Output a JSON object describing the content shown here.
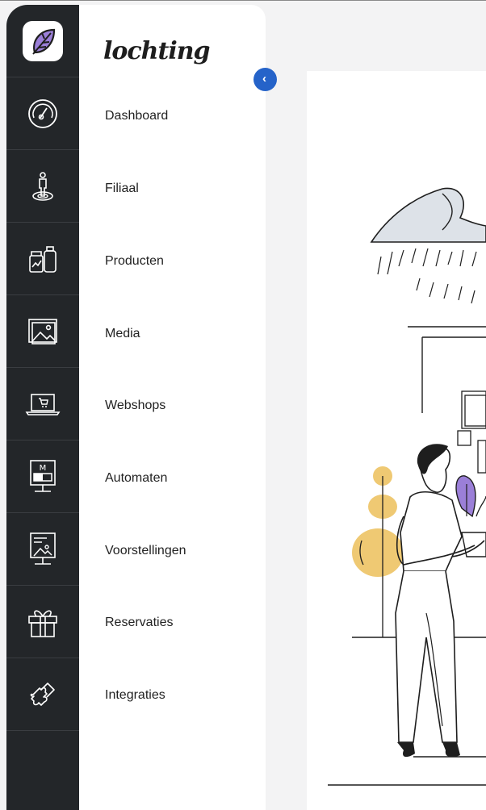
{
  "brand": {
    "logo_text": "lochting"
  },
  "sidebar": {
    "items": [
      {
        "label": "Dashboard",
        "icon": "gauge-icon"
      },
      {
        "label": "Filiaal",
        "icon": "person-location-icon"
      },
      {
        "label": "Producten",
        "icon": "products-icon"
      },
      {
        "label": "Media",
        "icon": "image-icon"
      },
      {
        "label": "Webshops",
        "icon": "laptop-cart-icon"
      },
      {
        "label": "Automaten",
        "icon": "vending-machine-icon"
      },
      {
        "label": "Voorstellingen",
        "icon": "presentation-icon"
      },
      {
        "label": "Reservaties",
        "icon": "gift-icon"
      },
      {
        "label": "Integraties",
        "icon": "puzzle-icon"
      }
    ],
    "collapse_icon": "chevron-left-icon"
  },
  "colors": {
    "rail": "#232629",
    "accent": "#2563c9",
    "illustration_purple": "#9b7fd8",
    "illustration_yellow": "#efc973"
  },
  "main": {
    "illustration": "person-with-plant-illustration"
  }
}
